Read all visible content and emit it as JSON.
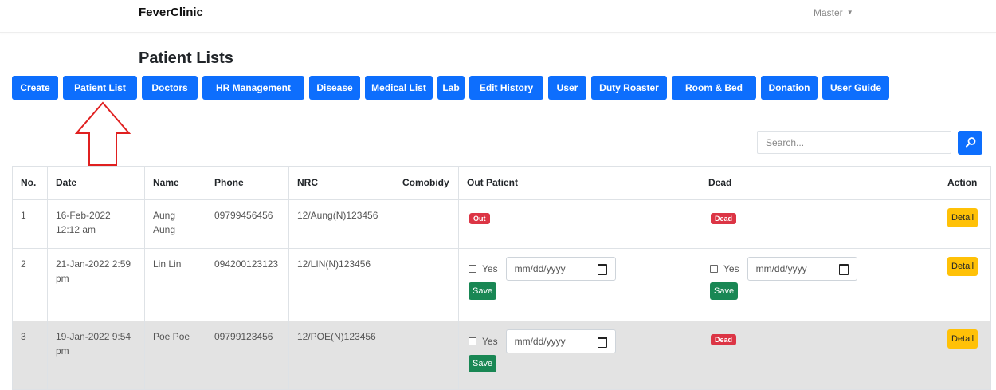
{
  "app": {
    "brand": "FeverClinic",
    "user_label": "Master"
  },
  "page": {
    "title": "Patient Lists"
  },
  "nav": [
    {
      "label": "Create"
    },
    {
      "label": "Patient List"
    },
    {
      "label": "Doctors"
    },
    {
      "label": "HR Management"
    },
    {
      "label": "Disease"
    },
    {
      "label": "Medical List"
    },
    {
      "label": "Lab"
    },
    {
      "label": "Edit History"
    },
    {
      "label": "User"
    },
    {
      "label": "Duty Roaster"
    },
    {
      "label": "Room & Bed"
    },
    {
      "label": "Donation"
    },
    {
      "label": "User Guide"
    }
  ],
  "search": {
    "placeholder": "Search..."
  },
  "table": {
    "headers": [
      "No.",
      "Date",
      "Name",
      "Phone",
      "NRC",
      "Comobidy",
      "Out Patient",
      "Dead",
      "Action"
    ],
    "labels": {
      "out": "Out",
      "dead": "Dead",
      "yes": "Yes",
      "date_placeholder": "mm/dd/yyyy",
      "save": "Save",
      "detail": "Detail"
    },
    "rows": [
      {
        "no": "1",
        "date": "16-Feb-2022 12:12 am",
        "name": "Aung Aung",
        "phone": "09799456456",
        "nrc": "12/Aung(N)123456",
        "comobidy": "",
        "out_status": "Out",
        "dead_status": "Dead"
      },
      {
        "no": "2",
        "date": "21-Jan-2022 2:59 pm",
        "name": "Lin Lin",
        "phone": "094200123123",
        "nrc": "12/LIN(N)123456",
        "comobidy": "",
        "out_status": "form",
        "dead_status": "form"
      },
      {
        "no": "3",
        "date": "19-Jan-2022 9:54 pm",
        "name": "Poe Poe",
        "phone": "09799123456",
        "nrc": "12/POE(N)123456",
        "comobidy": "",
        "out_status": "form",
        "dead_status": "Dead"
      }
    ]
  },
  "colors": {
    "primary": "#0d6efd",
    "danger": "#dc3545",
    "warning": "#ffc107",
    "success": "#198754",
    "annotation": "#e02020"
  }
}
